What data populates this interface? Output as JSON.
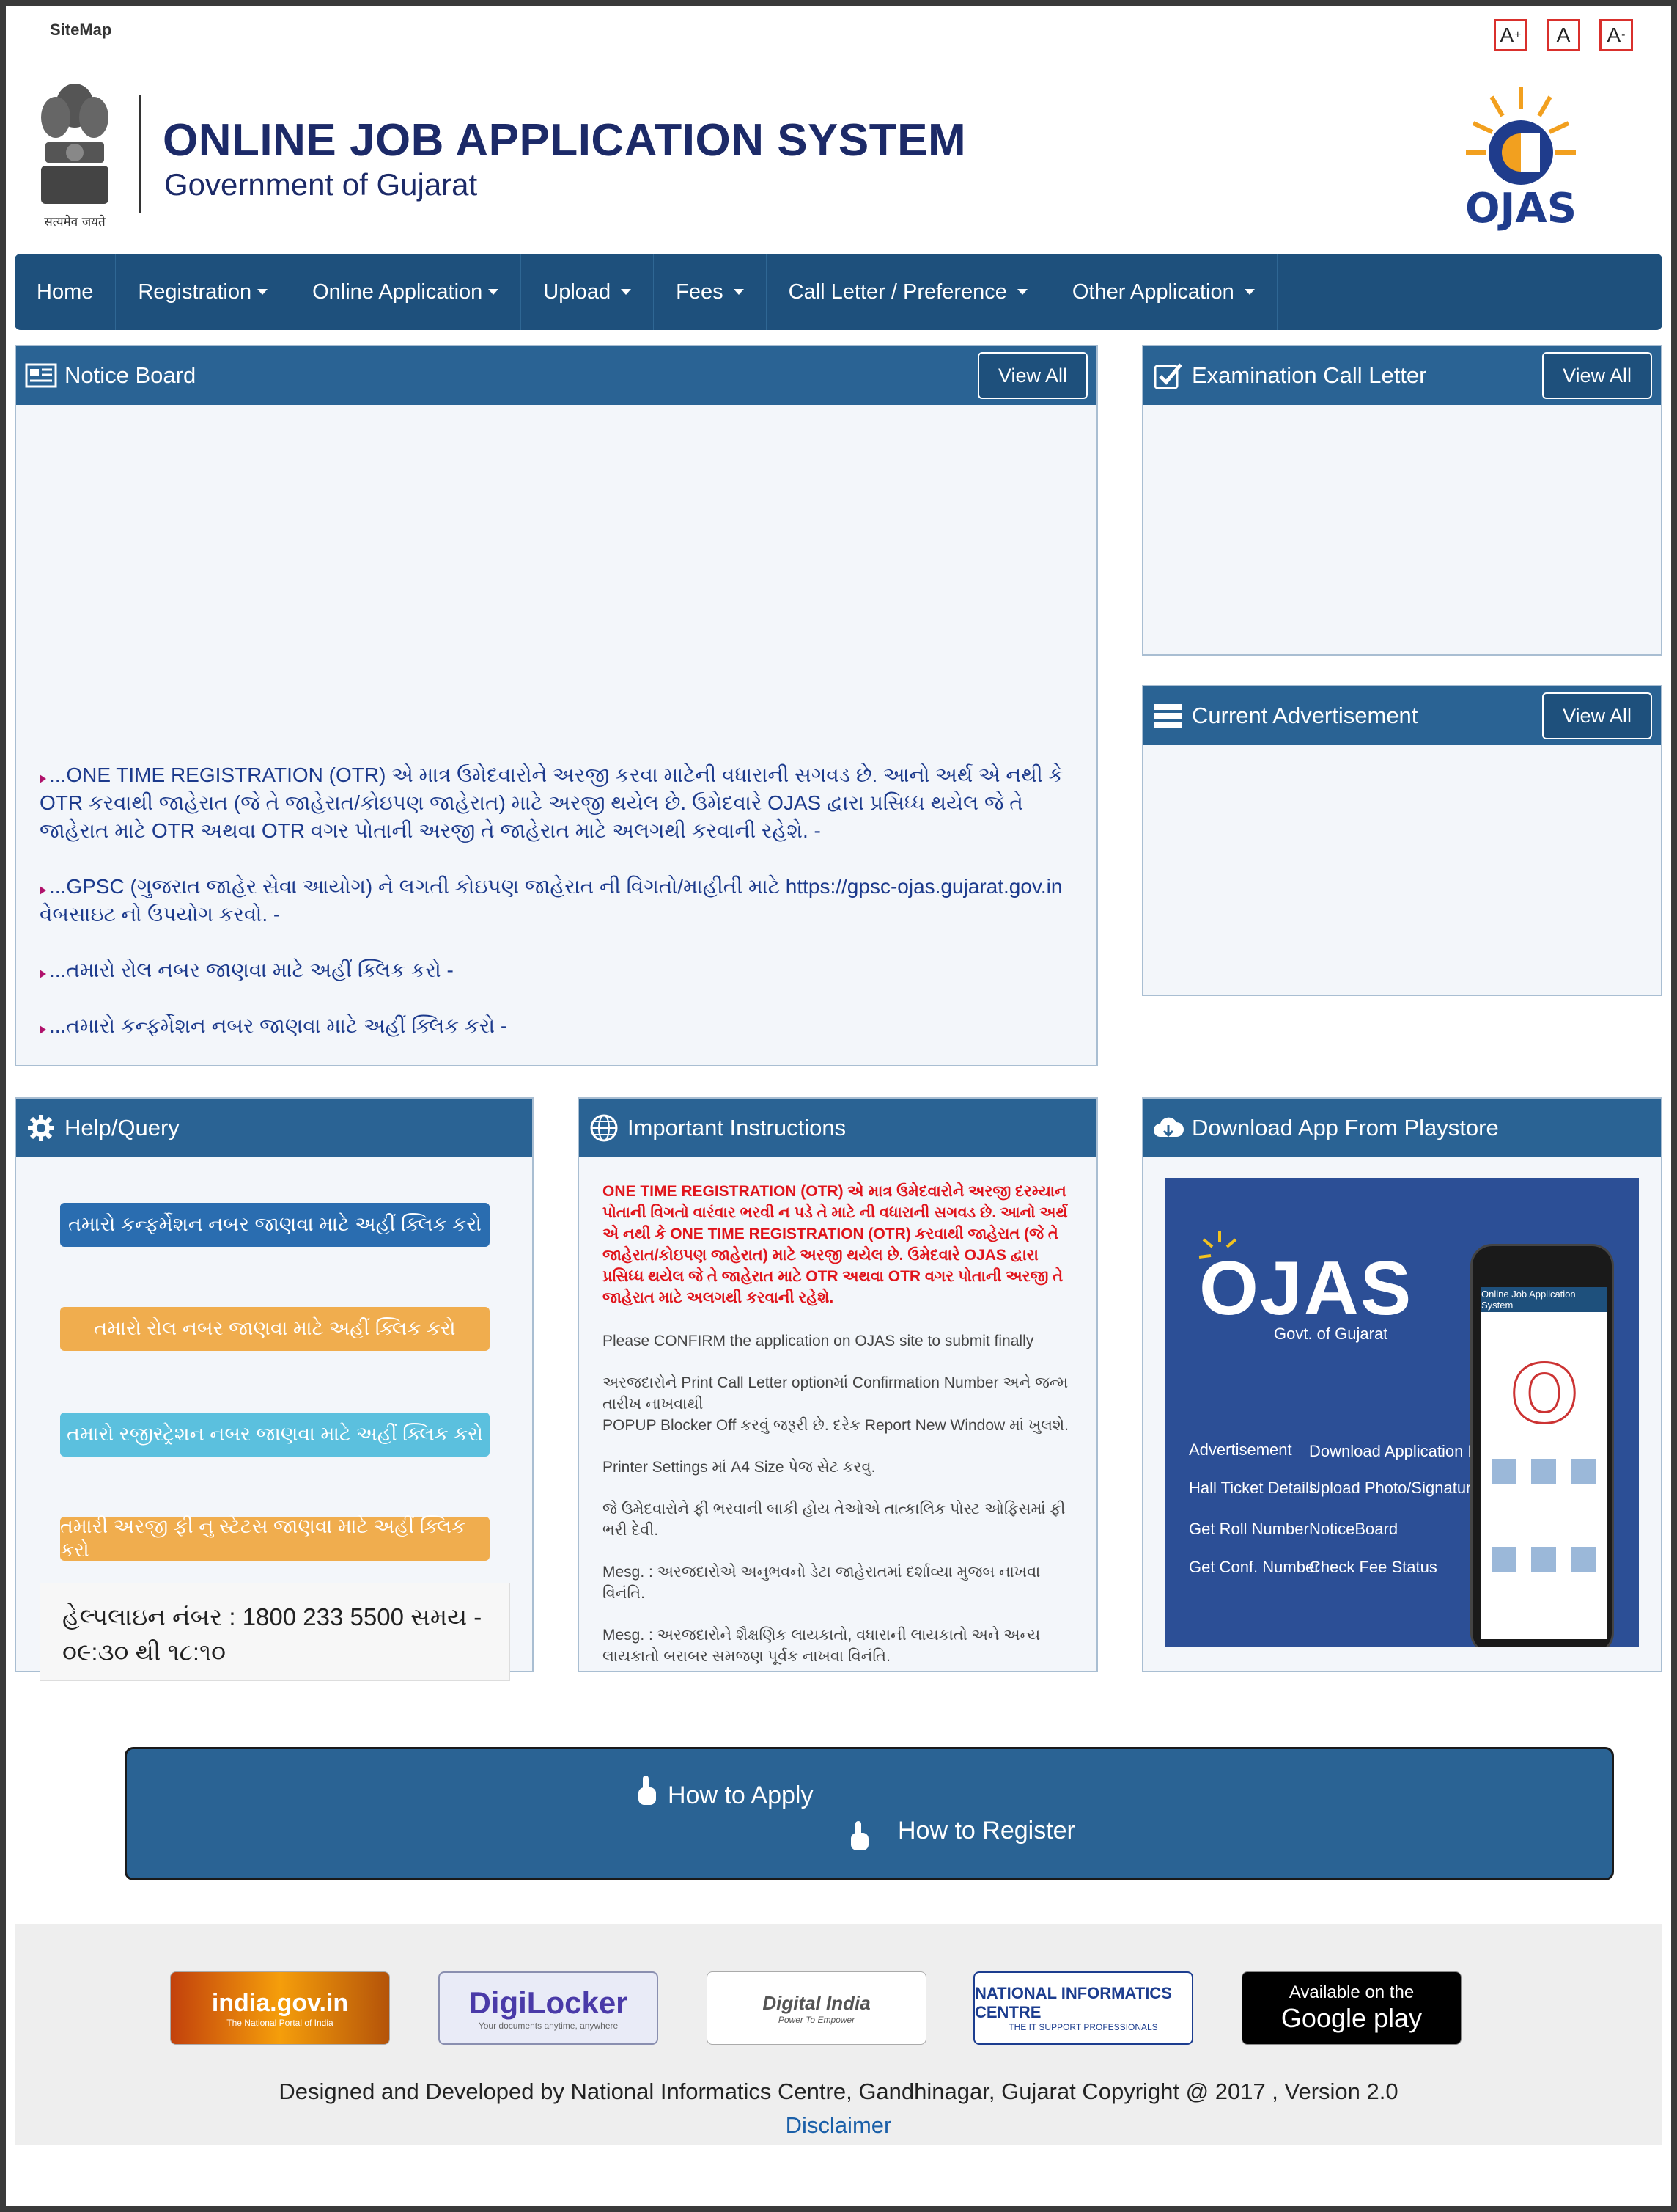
{
  "topbar": {
    "sitemap": "SiteMap",
    "font_increase": "A",
    "font_increase_sup": "+",
    "font_normal": "A",
    "font_decrease": "A",
    "font_decrease_sup": "-"
  },
  "header": {
    "emblem_motto": "सत्यमेव जयते",
    "title": "ONLINE JOB APPLICATION SYSTEM",
    "subtitle": "Government of Gujarat",
    "logo_text": "OJAS"
  },
  "nav": [
    {
      "label": "Home",
      "dropdown": false
    },
    {
      "label": "Registration",
      "dropdown": true
    },
    {
      "label": "Online Application",
      "dropdown": true
    },
    {
      "label": "Upload",
      "dropdown": true
    },
    {
      "label": "Fees",
      "dropdown": true
    },
    {
      "label": "Call Letter / Preference",
      "dropdown": true
    },
    {
      "label": "Other Application",
      "dropdown": true
    }
  ],
  "notice_board": {
    "title": "Notice Board",
    "view_all": "View All",
    "items": [
      "...ONE TIME REGISTRATION (OTR) એ માત્ર ઉમેદવારોને અરજી કરવા માટેની વધારાની સગવડ છે. આનો અર્થ એ નથી કે OTR કરવાથી જાહેરાત (જે તે જાહેરાત/કોઇપણ જાહેરાત) માટે અરજી થયેલ છે. ઉમેદવારે OJAS દ્વારા પ્રસિધ્ધ થયેલ જે તે જાહેરાત માટે OTR અથવા OTR વગર પોતાની અરજી તે જાહેરાત માટે અલગથી કરવાની રહેશે. -",
      "...GPSC (ગુજરાત જાહેર સેવા આયોગ) ને લગતી કોઇપણ જાહેરાત ની વિગતો/માહીતી માટે https://gpsc-ojas.gujarat.gov.in વેબસાઇટ નો ઉપયોગ કરવો. -",
      "...તમારો રોલ નબર જાણવા માટે અહીં ક્લિક કરો -",
      "...તમારો કન્ફર્મેશન નબર જાણવા માટે અહીં ક્લિક કરો -"
    ]
  },
  "exam_call_letter": {
    "title": "Examination Call Letter",
    "view_all": "View All"
  },
  "current_advertisement": {
    "title": "Current Advertisement",
    "view_all": "View All"
  },
  "help": {
    "title": "Help/Query",
    "buttons": [
      {
        "label": "તમારો કન્ફર્મેશન નબર જાણવા માટે અહીં ક્લિક કરો",
        "color": "#2a6db0"
      },
      {
        "label": "તમારો રોલ નબર જાણવા માટે અહીં ક્લિક કરો",
        "color": "#f0ad4e"
      },
      {
        "label": "તમારો રજીસ્ટ્રેશન નબર જાણવા માટે અહીં ક્લિક કરો",
        "color": "#5bc0de"
      },
      {
        "label": "તમારી અરજી ફી નુ સ્ટેટસ જાણવા માટે અહીં ક્લિક કરો",
        "color": "#f0ad4e"
      }
    ],
    "helpline": "હેલ્પલાઇન નંબર : 1800 233 5500 સમય - ૦૯:૩૦ થી ૧૮:૧૦"
  },
  "instructions": {
    "title": "Important Instructions",
    "red_text": "ONE TIME REGISTRATION (OTR) એ માત્ર ઉમેદવારોને અરજી દરમ્યાન પોતાની વિગતો વારંવાર ભરવી ન પડે તે માટે ની વધારાની સગવડ છે. આનો અર્થ એ નથી કે ONE TIME REGISTRATION (OTR) કરવાથી જાહેરાત (જે તે જાહેરાત/કોઇપણ જાહેરાત) માટે અરજી થયેલ છે. ઉમેદવારે OJAS દ્વારા પ્રસિધ્ધ થયેલ જે તે જાહેરાત માટે OTR અથવા OTR વગર પોતાની અરજી તે જાહેરાત માટે અલગથી કરવાની રહેશે.",
    "items": [
      "Please CONFIRM the application on OJAS site to submit finally",
      "અરજદારોને Print Call Letter optionમાં Confirmation Number અને જન્મ તારીખ નાખવાથી\nPOPUP Blocker Off કરવું જરૂરી છે. દરેક Report New Window માં ખુલશે.",
      "Printer Settings માં A4 Size પેજ સેટ કરવુ.",
      "જે ઉમેદવારોને ફી ભરવાની બાકી હોય તેઓએ તાત્કાલિક પોસ્ટ ઓફિસમાં ફી ભરી દેવી.",
      "Mesg. : અરજદારોએ અનુભવનો ડેટા જાહેરાતમાં દર્શાવ્યા મુજબ નાખવા વિનંતિ.",
      "Mesg. : અરજદારોને શૈક્ષણિક લાયકાતો, વધારાની લાયકાતો અને અન્ય લાયકાતો બરાબર સમજણ પૂર્વક નાખવા વિનંતિ."
    ]
  },
  "playstore": {
    "title": "Download App From Playstore",
    "promo_title": "OJAS",
    "promo_sub": "Govt. of Gujarat",
    "menu_left": [
      "Advertisement",
      "Hall Ticket Details",
      "Get Roll Number",
      "Get Conf. Number"
    ],
    "menu_right": [
      "Download Application Form",
      "Upload Photo/Signature",
      "NoticeBoard",
      "Check Fee Status"
    ],
    "phone_header": "Online Job Application System"
  },
  "howto": {
    "apply": "How to Apply",
    "register": "How to Register"
  },
  "footer": {
    "logos": [
      "india.gov.in",
      "DigiLocker",
      "Digital India",
      "NATIONAL INFORMATICS CENTRE",
      "Google play"
    ],
    "logo_captions": [
      "The National Portal of India",
      "Your documents anytime, anywhere",
      "Power To Empower",
      "THE IT SUPPORT PROFESSIONALS",
      "Available on the"
    ],
    "copyright": "Designed and Developed by National Informatics Centre, Gandhinagar, Gujarat Copyright @ 2017 , Version 2.0",
    "disclaimer": "Disclaimer"
  }
}
